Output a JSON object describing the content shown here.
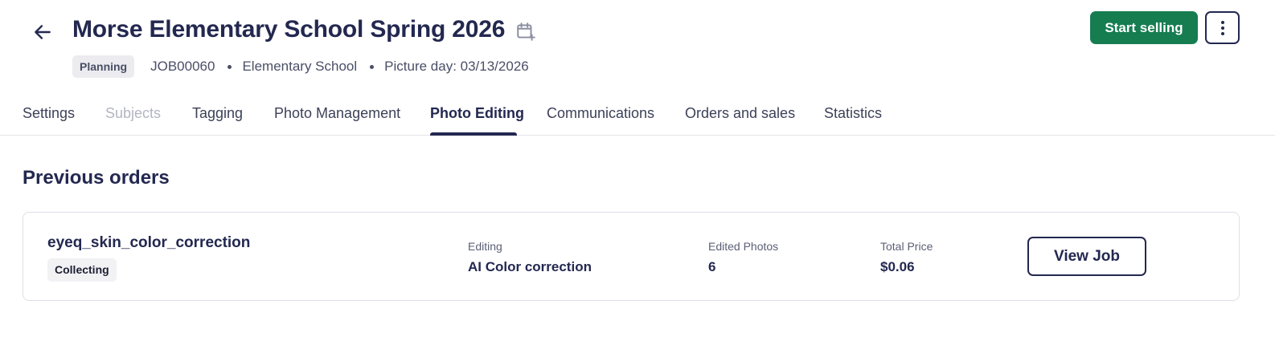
{
  "header": {
    "title": "Morse Elementary School Spring 2026",
    "status_badge": "Planning",
    "job_id": "JOB00060",
    "school_type": "Elementary School",
    "picture_day": "Picture day: 03/13/2026",
    "start_selling_label": "Start selling",
    "icons": {
      "back": "arrow-left-icon",
      "calendar": "calendar-plus-icon",
      "more": "more-vertical-icon"
    }
  },
  "tabs": [
    {
      "label": "Settings",
      "state": "normal"
    },
    {
      "label": "Subjects",
      "state": "disabled"
    },
    {
      "label": "Tagging",
      "state": "normal"
    },
    {
      "label": "Photo Management",
      "state": "normal"
    },
    {
      "label": "Photo Editing",
      "state": "active"
    },
    {
      "label": "Communications",
      "state": "normal"
    },
    {
      "label": "Orders and sales",
      "state": "normal"
    },
    {
      "label": "Statistics",
      "state": "normal"
    }
  ],
  "section": {
    "title": "Previous orders"
  },
  "orders": [
    {
      "name": "eyeq_skin_color_correction",
      "status": "Collecting",
      "editing_label": "Editing",
      "editing_value": "AI Color correction",
      "edited_photos_label": "Edited Photos",
      "edited_photos_value": "6",
      "total_price_label": "Total Price",
      "total_price_value": "$0.06",
      "view_label": "View Job"
    }
  ],
  "colors": {
    "primary": "#232850",
    "accent_green": "#167d51",
    "muted": "#b3b5c2",
    "border": "#dfe0e6"
  }
}
